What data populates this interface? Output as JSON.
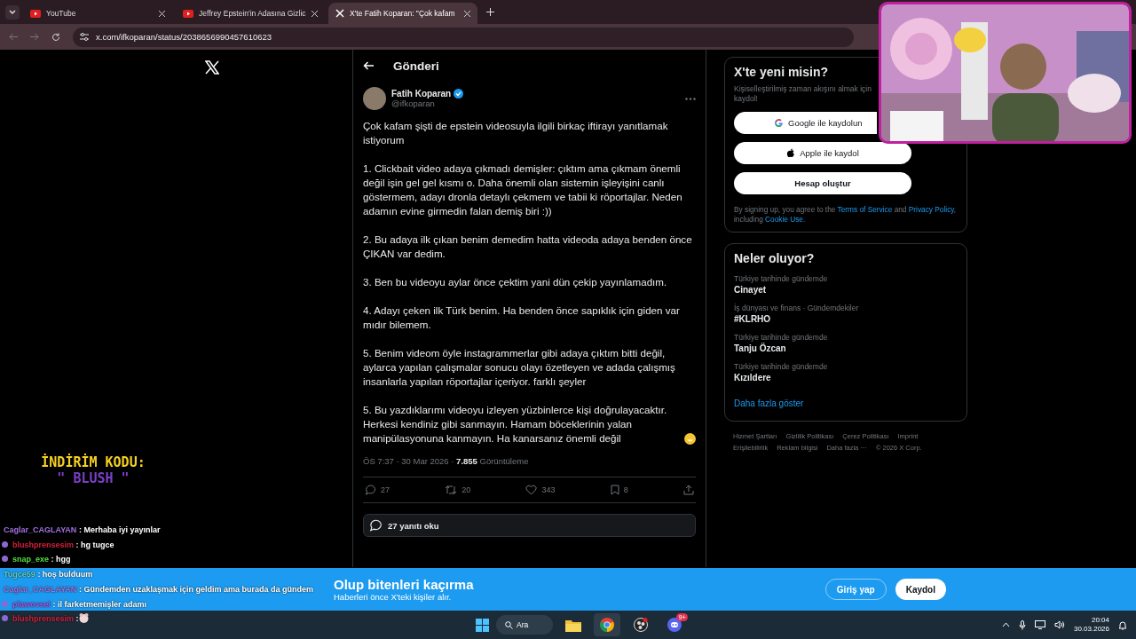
{
  "browser": {
    "tabs": [
      {
        "title": "YouTube",
        "kind": "youtube",
        "selected": false
      },
      {
        "title": "Jeffrey Epstein'in Adasına Gizlic",
        "kind": "youtube",
        "selected": false
      },
      {
        "title": "X'te Fatih Koparan: \"Çok kafam",
        "kind": "x",
        "selected": true
      }
    ],
    "url": "x.com/ifkoparan/status/2038656990457610623"
  },
  "header": {
    "title": "Gönderi"
  },
  "post": {
    "author": "Fatih Koparan",
    "handle": "@ifkoparan",
    "verified": true,
    "paragraphs": [
      "Çok kafam şişti de epstein videosuyla ilgili birkaç iftirayı yanıtlamak istiyorum",
      "1. Clickbait video adaya çıkmadı demişler: çıktım ama çıkmam önemli değil işin gel gel kısmı o. Daha önemli olan sistemin işleyişini canlı göstermem, adayı dronla detaylı çekmem ve tabii ki röportajlar. Neden adamın evine girmedin falan demiş biri :))",
      "2. Bu adaya ilk çıkan benim demedim hatta videoda adaya benden önce ÇIKAN var dedim.",
      "3. Ben bu videoyu aylar önce çektim yani dün çekip yayınlamadım.",
      "4. Adayı çeken ilk Türk benim. Ha benden önce sapıklık için giden var mıdır bilemem.",
      "5. Benim videom öyle instagrammerlar gibi adaya çıktım bitti değil, aylarca yapılan çalışmalar sonucu olayı özetleyen ve adada çalışmış insanlarla yapılan röportajlar içeriyor. farklı şeyler",
      "5. Bu yazdıklarımı videoyu izleyen yüzbinlerce kişi doğrulayacaktır. Herkesi kendiniz gibi sanmayın. Hamam böceklerinin yalan manipülasyonuna kanmayın. Ha kanarsanız önemli değil"
    ],
    "meta": "ÖS 7:37 · 30 Mar 2026 · **7.855** Görüntüleme",
    "actions": [
      {
        "kind": "reply",
        "count": "27"
      },
      {
        "kind": "repost",
        "count": "20"
      },
      {
        "kind": "like",
        "count": "343"
      },
      {
        "kind": "bookmark",
        "count": "8"
      },
      {
        "kind": "share"
      }
    ],
    "read_replies": "27 yanıtı oku"
  },
  "signup": {
    "title": "X'te yeni misin?",
    "subtitle": "Kişiselleştirilmiş zaman akışını almak için kaydol!",
    "buttons": [
      {
        "kind": "google",
        "label": "Google ile kaydolun"
      },
      {
        "kind": "apple",
        "label": "Apple ile kaydol"
      },
      {
        "kind": "plain",
        "label": "Hesap oluştur"
      }
    ],
    "legal": "By signing up, you agree to the **Terms of Service** and **Privacy Policy**, including **Cookie Use.**"
  },
  "trends": {
    "title": "Neler oluyor?",
    "items": [
      {
        "context": "Türkiye tarihinde gündemde",
        "topic": "Cinayet"
      },
      {
        "context": "İş dünyası ve finans · Gündemdekiler",
        "topic": "#KLRHO"
      },
      {
        "context": "Türkiye tarihinde gündemde",
        "topic": "Tanju Özcan"
      },
      {
        "context": "Türkiye tarihinde gündemde",
        "topic": "Kızıldere"
      }
    ],
    "more": "Daha fazla göster"
  },
  "footer_links": [
    "Hizmet Şartları",
    "Gizlilik Politikası",
    "Çerez Politikası",
    "Imprint",
    "Erişilebilirlik",
    "Reklam bilgisi",
    "Daha fazla ···"
  ],
  "copyright": "© 2026 X Corp.",
  "overlay": {
    "promo_title": "İNDİRİM KODU:",
    "promo_code": "\" BLUSH \"",
    "chat": [
      {
        "user": "Caglar_CAGLAYAN",
        "color": "#a070e0",
        "badge": false,
        "text": ": Merhaba iyi yayınlar"
      },
      {
        "user": "blushprensesim",
        "color": "#d0203a",
        "badge": true,
        "text": ": hg tugce"
      },
      {
        "user": "snap_exe",
        "color": "#50e040",
        "badge": true,
        "text": ": hgg"
      },
      {
        "user": "Tugce59",
        "color": "#60d0c0",
        "badge": false,
        "text": ": hoş bulduum"
      },
      {
        "user": "Caglar_CAGLAYAN",
        "color": "#a070e0",
        "badge": false,
        "text": ": Gündemden uzaklaşmak için geldim ama burada da gündem"
      },
      {
        "user": "plawovsei",
        "color": "#b050e0",
        "badge": true,
        "text": ": il farketmemişler adamı"
      },
      {
        "user": "blushprensesim",
        "color": "#d0203a",
        "badge": true,
        "text": ":",
        "emote": true
      }
    ]
  },
  "banner": {
    "title": "Olup bitenleri kaçırma",
    "subtitle": "Haberleri önce X'teki kişiler alır.",
    "login": "Giriş yap",
    "signup": "Kaydol"
  },
  "taskbar": {
    "search": "Ara",
    "apps": [
      {
        "kind": "explorer",
        "active": false
      },
      {
        "kind": "chrome",
        "active": true
      },
      {
        "kind": "obs",
        "active": false
      },
      {
        "kind": "discord",
        "active": false,
        "badge": "9+"
      }
    ],
    "time": "20:04",
    "date": "30.03.2026"
  }
}
